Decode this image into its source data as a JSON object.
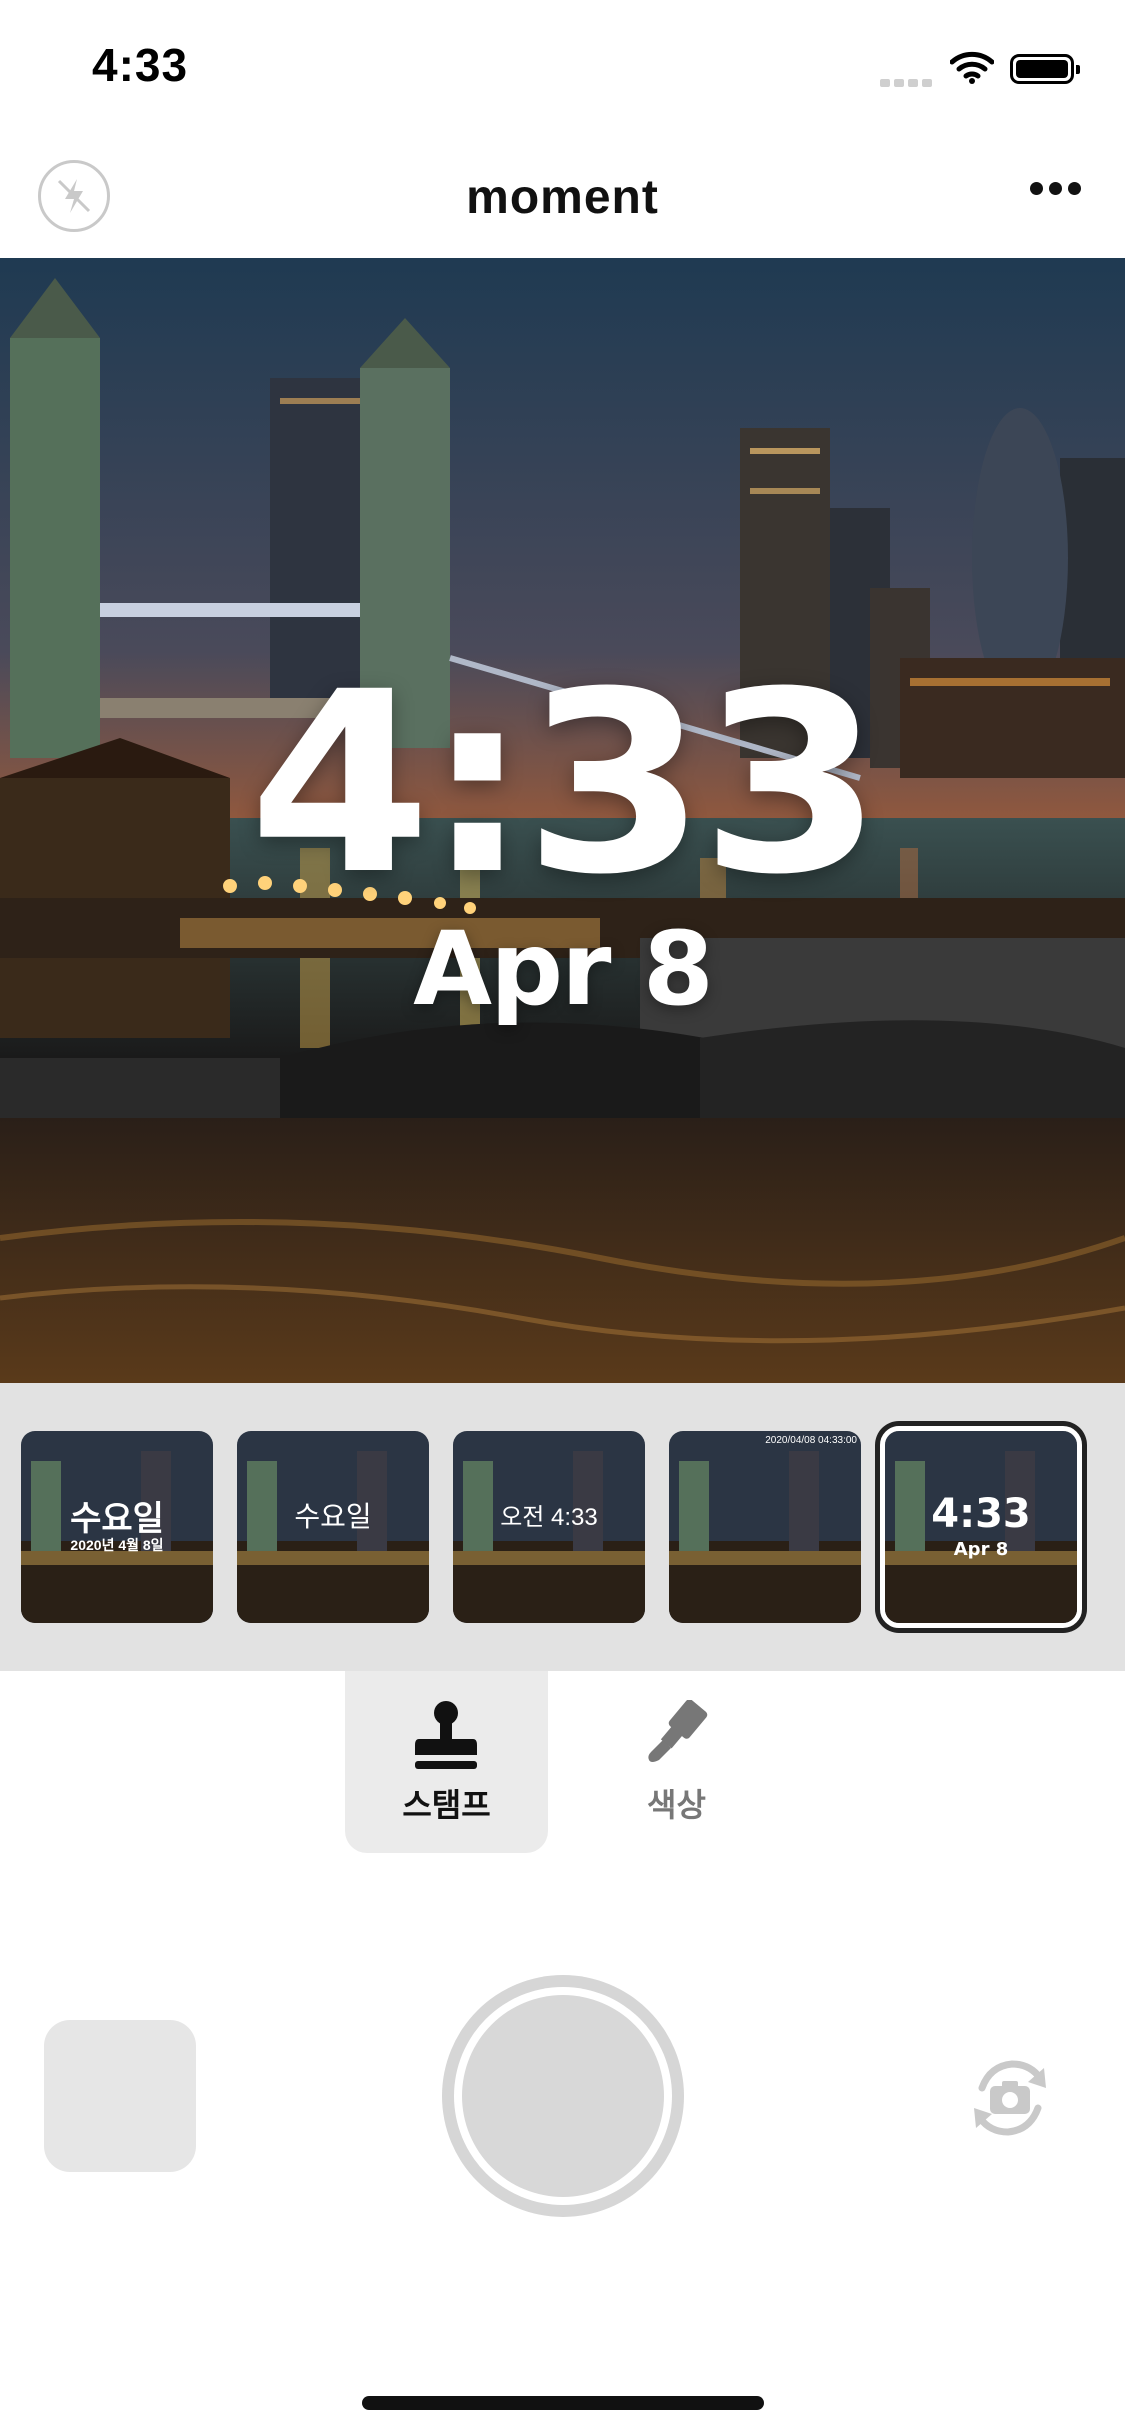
{
  "status_bar": {
    "time": "4:33"
  },
  "nav": {
    "title": "moment"
  },
  "photo_overlay": {
    "time": "4:33",
    "date": "Apr 8"
  },
  "thumbnails": [
    {
      "line1": "수요일",
      "line2": "2020년 4월 8일"
    },
    {
      "line1": "수요일",
      "line2": ""
    },
    {
      "line1": "오전 4:33",
      "line2": ""
    },
    {
      "line1": "",
      "line2": "",
      "corner": "2020/04/08 04:33:00"
    },
    {
      "line1": "4:33",
      "line2": "Apr 8",
      "selected": true
    }
  ],
  "tabs": [
    {
      "label": "스탬프",
      "icon": "stamp-icon",
      "active": true
    },
    {
      "label": "색상",
      "icon": "paint-brush-icon",
      "active": false
    }
  ],
  "colors": {
    "accent": "#111111",
    "strip_bg": "#e2e2e2",
    "tab_active_bg": "#ebebeb"
  }
}
